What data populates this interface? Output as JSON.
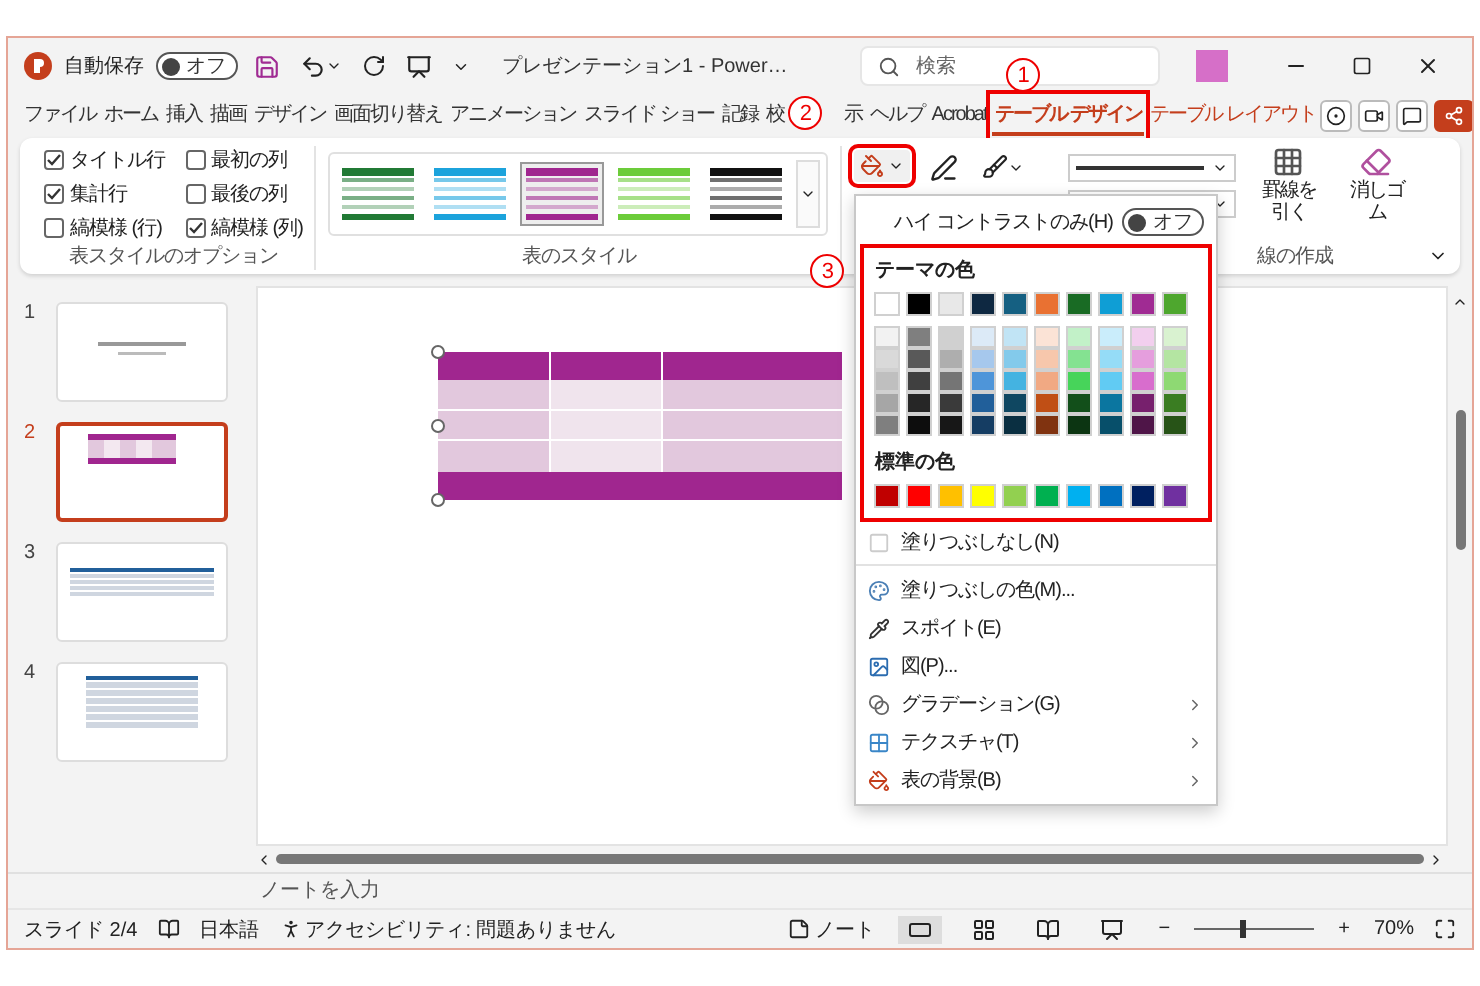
{
  "window": {
    "autosave_label": "自動保存",
    "autosave": {
      "on": false,
      "label": "オフ"
    },
    "title": "プレゼンテーション1 - Power…",
    "search": {
      "placeholder": "検索"
    }
  },
  "tabs": [
    {
      "label": "ファイル",
      "kind": "standard",
      "selected": false
    },
    {
      "label": "ホーム",
      "kind": "standard",
      "selected": false
    },
    {
      "label": "挿入",
      "kind": "standard",
      "selected": false
    },
    {
      "label": "描画",
      "kind": "standard",
      "selected": false
    },
    {
      "label": "デザイン",
      "kind": "standard",
      "selected": false
    },
    {
      "label": "画面切り替え",
      "kind": "standard",
      "selected": false
    },
    {
      "label": "アニメーション",
      "kind": "standard",
      "selected": false
    },
    {
      "label": "スライド ショー",
      "kind": "standard",
      "selected": false
    },
    {
      "label": "記録",
      "kind": "standard",
      "selected": false
    },
    {
      "label": "校",
      "kind": "standard",
      "selected": false
    },
    {
      "label": "示",
      "kind": "standard",
      "selected": false
    },
    {
      "label": "ヘルプ",
      "kind": "standard",
      "selected": false
    },
    {
      "label": "Acrobat",
      "kind": "standard",
      "selected": false
    },
    {
      "label": "テーブル デザイン",
      "kind": "contextual",
      "selected": true,
      "boxed": true,
      "callout": "1"
    },
    {
      "label": "テーブル レイアウト",
      "kind": "contextual",
      "selected": false
    }
  ],
  "ribbon": {
    "style_options": {
      "label": "表スタイルのオプション",
      "items": [
        {
          "label": "タイトル行",
          "checked": true
        },
        {
          "label": "最初の列",
          "checked": false
        },
        {
          "label": "集計行",
          "checked": true
        },
        {
          "label": "最後の列",
          "checked": false
        },
        {
          "label": "縞模様 (行)",
          "checked": false
        },
        {
          "label": "縞模様 (列)",
          "checked": true
        }
      ]
    },
    "table_styles": {
      "label": "表のスタイル",
      "items": [
        {
          "color": "#217a35",
          "selected": false
        },
        {
          "color": "#1ca3dc",
          "selected": false
        },
        {
          "color": "#a0268f",
          "selected": true
        },
        {
          "color": "#6ccc3a",
          "selected": false
        },
        {
          "color": "#111111",
          "selected": false
        }
      ]
    },
    "shading": {
      "boxed": true,
      "callout": "2"
    },
    "borders": {
      "draw_label": "罫線を引く",
      "erase_label": "消しゴム",
      "label": "線の作成"
    }
  },
  "shading_menu": {
    "high_contrast": {
      "label": "ハイ コントラストのみ(H)",
      "on": false,
      "state": "オフ"
    },
    "color_panel": {
      "boxed": true,
      "callout": "3",
      "theme_label": "テーマの色",
      "standard_label": "標準の色",
      "theme_colors": [
        {
          "color": "#ffffff",
          "shades": [
            {
              "color": "#f2f2f2"
            },
            {
              "color": "#d9d9d9"
            },
            {
              "color": "#bfbfbf"
            },
            {
              "color": "#a6a6a6"
            },
            {
              "color": "#7f7f7f"
            }
          ]
        },
        {
          "color": "#000000",
          "shades": [
            {
              "color": "#7f7f7f"
            },
            {
              "color": "#595959"
            },
            {
              "color": "#404040"
            },
            {
              "color": "#262626"
            },
            {
              "color": "#0d0d0d"
            }
          ]
        },
        {
          "color": "#e8e8e8",
          "shades": [
            {
              "color": "#d0d0d0"
            },
            {
              "color": "#aeaeae"
            },
            {
              "color": "#757575"
            },
            {
              "color": "#3a3a3a"
            },
            {
              "color": "#171717"
            }
          ]
        },
        {
          "color": "#0e2841",
          "shades": [
            {
              "color": "#dceaf7"
            },
            {
              "color": "#a6c8ed"
            },
            {
              "color": "#4e95d9"
            },
            {
              "color": "#215f9a"
            },
            {
              "color": "#153d63"
            }
          ]
        },
        {
          "color": "#156082",
          "shades": [
            {
              "color": "#c1e4f5"
            },
            {
              "color": "#83caeb"
            },
            {
              "color": "#44b3e1"
            },
            {
              "color": "#0f4761"
            },
            {
              "color": "#0a2f41"
            }
          ]
        },
        {
          "color": "#e97132",
          "shades": [
            {
              "color": "#fbe3d6"
            },
            {
              "color": "#f7c7ac"
            },
            {
              "color": "#f1a983"
            },
            {
              "color": "#c04f15"
            },
            {
              "color": "#803310"
            }
          ]
        },
        {
          "color": "#196b24",
          "shades": [
            {
              "color": "#c2f1c8"
            },
            {
              "color": "#84e291"
            },
            {
              "color": "#47d45a"
            },
            {
              "color": "#124f1a"
            },
            {
              "color": "#0c3512"
            }
          ]
        },
        {
          "color": "#0f9ed5",
          "shades": [
            {
              "color": "#caedfb"
            },
            {
              "color": "#95dcf7"
            },
            {
              "color": "#61cbf3"
            },
            {
              "color": "#0b76a0"
            },
            {
              "color": "#074f6a"
            }
          ]
        },
        {
          "color": "#a02b93",
          "shades": [
            {
              "color": "#f2cfee"
            },
            {
              "color": "#e59edd"
            },
            {
              "color": "#d86dcd"
            },
            {
              "color": "#77206d"
            },
            {
              "color": "#4f1548"
            }
          ]
        },
        {
          "color": "#4ea72e",
          "shades": [
            {
              "color": "#d9f2d0"
            },
            {
              "color": "#b4e5a2"
            },
            {
              "color": "#8ed973"
            },
            {
              "color": "#3a7d22"
            },
            {
              "color": "#275317"
            }
          ]
        }
      ],
      "standard_colors": [
        {
          "color": "#c00000"
        },
        {
          "color": "#ff0000"
        },
        {
          "color": "#ffc000"
        },
        {
          "color": "#ffff00"
        },
        {
          "color": "#92d050"
        },
        {
          "color": "#00b050"
        },
        {
          "color": "#00b0f0"
        },
        {
          "color": "#0070c0"
        },
        {
          "color": "#002060"
        },
        {
          "color": "#7030a0"
        }
      ]
    },
    "items": [
      {
        "label": "塗りつぶしなし(N)",
        "kind": "no-fill",
        "submenu": false
      },
      {
        "label": "塗りつぶしの色(M)...",
        "kind": "more-colors",
        "submenu": false
      },
      {
        "label": "スポイト(E)",
        "kind": "eyedropper",
        "submenu": false
      },
      {
        "label": "図(P)...",
        "kind": "picture",
        "submenu": false
      },
      {
        "label": "グラデーション(G)",
        "kind": "gradient",
        "submenu": true
      },
      {
        "label": "テクスチャ(T)",
        "kind": "texture",
        "submenu": true
      },
      {
        "label": "表の背景(B)",
        "kind": "table-background",
        "submenu": true
      }
    ]
  },
  "slides": [
    {
      "number": "1",
      "kind": "title",
      "selected": false
    },
    {
      "number": "2",
      "kind": "purple-table",
      "selected": true
    },
    {
      "number": "3",
      "kind": "blue-table",
      "selected": false
    },
    {
      "number": "4",
      "kind": "blue-table-tall",
      "selected": false
    }
  ],
  "notes": {
    "placeholder": "ノートを入力"
  },
  "status_bar": {
    "slide": "スライド 2/4",
    "language": "日本語",
    "accessibility": "アクセシビリティ: 問題ありません",
    "notes": "ノート",
    "views": [
      {
        "kind": "normal",
        "selected": true
      },
      {
        "kind": "sorter",
        "selected": false
      },
      {
        "kind": "reading",
        "selected": false
      },
      {
        "kind": "slideshow",
        "selected": false
      }
    ],
    "zoom": {
      "out": "−",
      "in": "+",
      "level": 0.4,
      "label": "70%"
    }
  }
}
